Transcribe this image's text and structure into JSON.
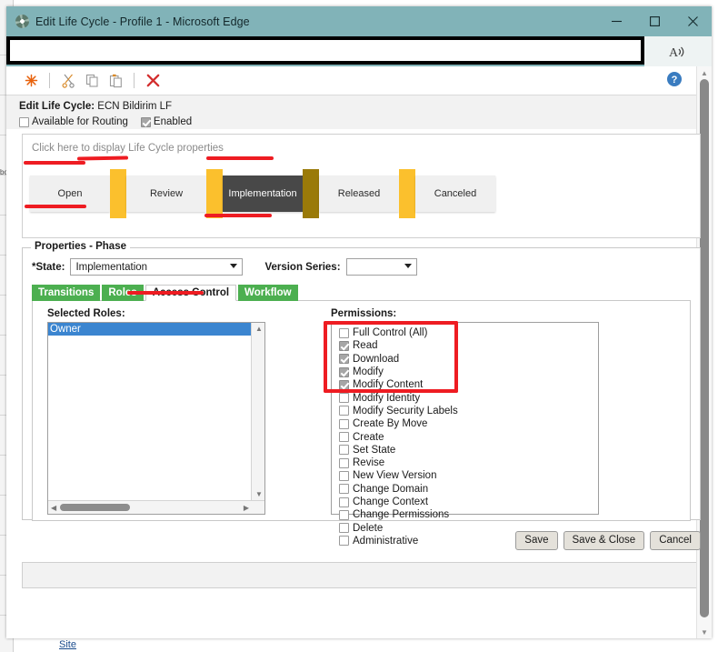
{
  "window": {
    "title": "Edit Life Cycle - Profile 1 - Microsoft Edge",
    "minimize_label": "Minimize",
    "maximize_label": "Maximize",
    "close_label": "Close",
    "favicon_name": "windchill-favicon",
    "titlebar_color": "#81b3b8"
  },
  "omnibox": {
    "value": "",
    "placeholder": "",
    "read_aloud_label": "Read aloud"
  },
  "toolbar": {
    "items": [
      {
        "name": "new-icon",
        "glyph": "✳",
        "color": "#e8620c",
        "title": "New"
      },
      {
        "name": "cut-icon",
        "glyph": "✂",
        "color": "#9a9a9a",
        "title": "Cut"
      },
      {
        "name": "copy-icon",
        "glyph": "❐",
        "color": "#9a9a9a",
        "title": "Copy"
      },
      {
        "name": "paste-icon",
        "glyph": "❏",
        "color": "#9a9a9a",
        "title": "Paste"
      },
      {
        "name": "delete-icon",
        "glyph": "✗",
        "color": "#d32f2f",
        "title": "Delete"
      }
    ],
    "help_label": "Help"
  },
  "header": {
    "title_prefix": "Edit Life Cycle:",
    "lifecycle_name": "ECN Bildirim LF",
    "checkboxes": [
      {
        "label": "Available for Routing",
        "checked": false
      },
      {
        "label": "Enabled",
        "checked": true
      }
    ]
  },
  "lifecycle": {
    "hint": "Click here to display Life Cycle properties",
    "phases": [
      {
        "label": "Open",
        "active": false
      },
      {
        "label": "Review",
        "active": false
      },
      {
        "label": "Implementation",
        "active": true
      },
      {
        "label": "Released",
        "active": false
      },
      {
        "label": "Canceled",
        "active": false
      }
    ],
    "gate_color": "#fbc02d",
    "gate_dark_color": "#9a7a09",
    "active_phase_color": "#484848"
  },
  "properties": {
    "legend": "Properties - Phase",
    "state_label": "*State:",
    "state_value": "Implementation",
    "version_series_label": "Version Series:",
    "version_series_value": "",
    "tabs": [
      {
        "label": "Transitions",
        "active": false
      },
      {
        "label": "Roles",
        "active": false
      },
      {
        "label": "Access Control",
        "active": true
      },
      {
        "label": "Workflow",
        "active": false
      }
    ],
    "tab_color": "#4caf50"
  },
  "roles": {
    "label": "Selected Roles:",
    "items": [
      {
        "label": "Owner",
        "selected": true
      }
    ]
  },
  "permissions": {
    "label": "Permissions:",
    "items": [
      {
        "label": "Full Control (All)",
        "checked": false
      },
      {
        "label": "Read",
        "checked": true
      },
      {
        "label": "Download",
        "checked": true
      },
      {
        "label": "Modify",
        "checked": true
      },
      {
        "label": "Modify Content",
        "checked": true
      },
      {
        "label": "Modify Identity",
        "checked": false
      },
      {
        "label": "Modify Security Labels",
        "checked": false
      },
      {
        "label": "Create By Move",
        "checked": false
      },
      {
        "label": "Create",
        "checked": false
      },
      {
        "label": "Set State",
        "checked": false
      },
      {
        "label": "Revise",
        "checked": false
      },
      {
        "label": "New View Version",
        "checked": false
      },
      {
        "label": "Change Domain",
        "checked": false
      },
      {
        "label": "Change Context",
        "checked": false
      },
      {
        "label": "Change Permissions",
        "checked": false
      },
      {
        "label": "Delete",
        "checked": false
      },
      {
        "label": "Administrative",
        "checked": false
      }
    ]
  },
  "footer": {
    "buttons": [
      {
        "label": "Save"
      },
      {
        "label": "Save & Close"
      },
      {
        "label": "Cancel"
      }
    ]
  },
  "background_page": {
    "site_link": "Site",
    "side_text": "bo"
  },
  "annotations": {
    "color": "#ee1c22",
    "notes": [
      "underline above Open phase",
      "underline below Open phase",
      "underline above Implementation phase",
      "underline below Implementation phase",
      "underline under Access Control tab",
      "rectangle around first five permissions"
    ]
  }
}
